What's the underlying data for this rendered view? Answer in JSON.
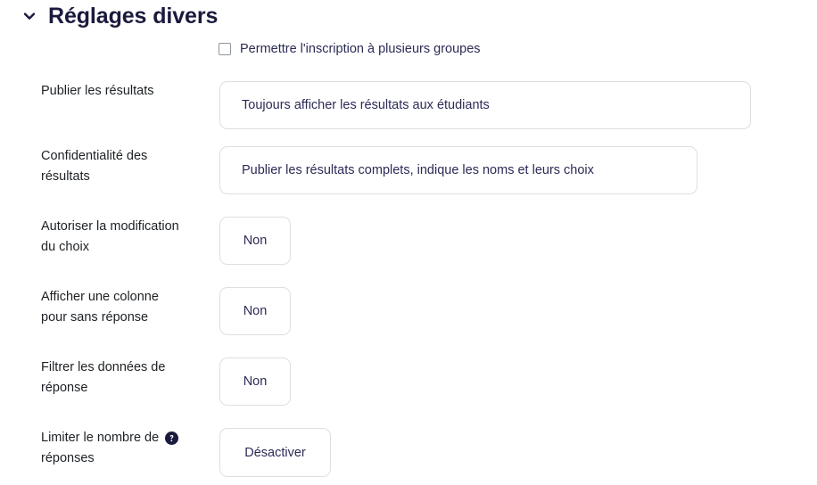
{
  "section": {
    "title": "Réglages divers",
    "collapse_icon": "chevron-down-icon",
    "expanded": true
  },
  "multi_group_checkbox": {
    "label": "Permettre l'inscription à plusieurs groupes",
    "checked": false
  },
  "fields": [
    {
      "label": "Publier les résultats",
      "control": "select",
      "value": "Toujours afficher les résultats aux étudiants",
      "help": false
    },
    {
      "label_line1": "Confidentialité des",
      "label_line2": "résultats",
      "control": "select",
      "value": "Publier les résultats complets, indique les noms et leurs choix",
      "help": false
    },
    {
      "label_line1": "Autoriser la modification",
      "label_line2": "du choix",
      "control": "button",
      "value": "Non",
      "help": false
    },
    {
      "label_line1": "Afficher une colonne",
      "label_line2": "pour sans réponse",
      "control": "button",
      "value": "Non",
      "help": false
    },
    {
      "label_line1": "Filtrer les données de",
      "label_line2": "réponse",
      "control": "button",
      "value": "Non",
      "help": false
    },
    {
      "label_line1": "Limiter le nombre de",
      "label_line2": "réponses",
      "control": "button",
      "value": "Désactiver",
      "help": true,
      "help_icon": "help-circle-icon"
    }
  ],
  "colors": {
    "heading": "#1a1a3d",
    "label_text": "#1d2125",
    "control_text": "#2b2b56",
    "border": "#dcdfe3",
    "checkbox_border": "#8f959e",
    "help_icon": "#1a1a3d",
    "background": "#ffffff"
  }
}
